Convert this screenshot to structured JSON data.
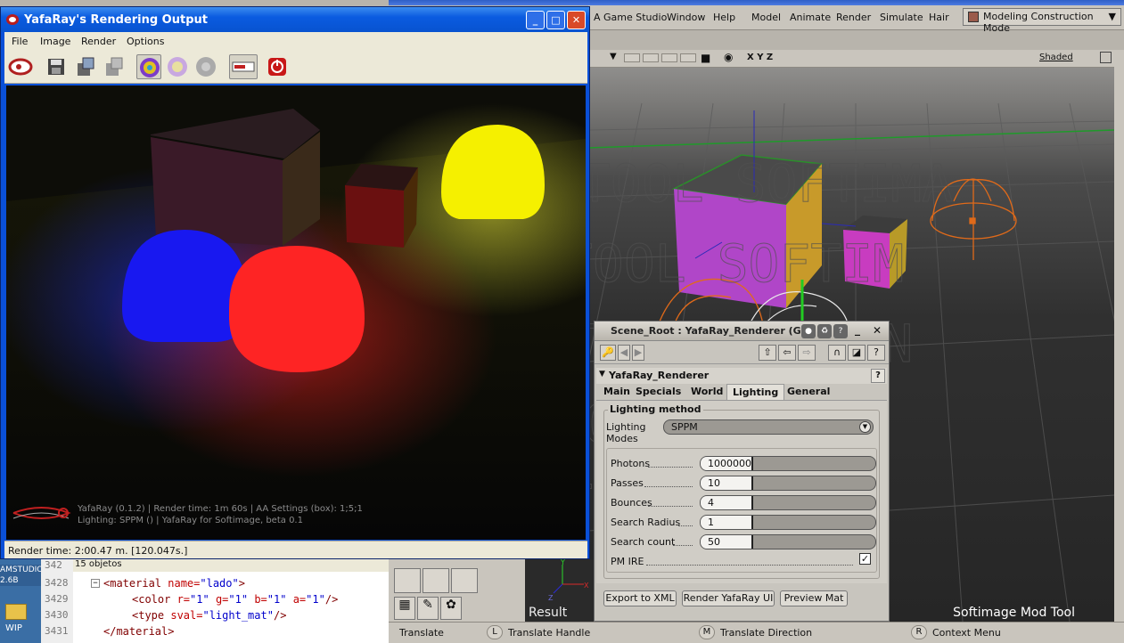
{
  "softimage": {
    "menus": [
      "A Game Studio",
      "Window",
      "Help",
      "Model",
      "Animate",
      "Render",
      "Simulate",
      "Hair"
    ],
    "mode_button": "Modeling Construction Mode",
    "view_axes": "X Y Z",
    "shading_mode": "Shaded",
    "status_bar": {
      "left_mouse": "Translate",
      "middle_key": "L",
      "middle_mouse": "Translate Handle",
      "m_key": "M",
      "m_action": "Translate Direction",
      "r_key": "R",
      "right_mouse": "Context Menu"
    },
    "result_label": "Result",
    "watermark_labels": "Softimage  Mod  Tool"
  },
  "desktop": {
    "icon_top_label": "AMSTUDIO 2.6B",
    "icon_bottom_label": "WIP"
  },
  "editor": {
    "header": "15 objetos",
    "line_numbers": [
      "342",
      "3428",
      "3429",
      "3430",
      "3431"
    ],
    "lines": [
      {
        "tag_open": "<material ",
        "attr": "name=",
        "val": "\"lado\"",
        "tag_close": ">"
      },
      {
        "tag_open": "<color ",
        "attr": "r=",
        "val": "\"1\"",
        "attr2": " g=",
        "val2": "\"1\"",
        "attr3": " b=",
        "val3": "\"1\"",
        "attr4": " a=",
        "val4": "\"1\"",
        "tag_close": "/>"
      },
      {
        "tag_open": "<type ",
        "attr": "sval=",
        "val": "\"light_mat\"",
        "tag_close": "/>"
      },
      {
        "tag_open": "</material>"
      }
    ]
  },
  "yafaray_window": {
    "title": "YafaRay's Rendering Output",
    "menus": [
      "File",
      "Image",
      "Render",
      "Options"
    ],
    "overlay_line1": "YafaRay (0.1.2) | Render time: 1m 60s | AA Settings (box): 1;5;1",
    "overlay_line2": "Lighting: SPPM () | YafaRay for Softimage, beta 0.1",
    "status": "Render time: 2:00.47 m. [120.047s.]"
  },
  "property_panel": {
    "title": "Scene_Root : YafaRay_Renderer (G...",
    "section": "YafaRay_Renderer",
    "tabs": [
      "Main",
      "Specials",
      "World",
      "Lighting",
      "General"
    ],
    "active_tab": "Lighting",
    "group_title": "Lighting method",
    "lighting_modes_label1": "Lighting",
    "lighting_modes_label2": "Modes",
    "lighting_mode_value": "SPPM",
    "params": [
      {
        "label": "Photons",
        "value": "1000000",
        "fill": 0.3
      },
      {
        "label": "Passes",
        "value": "10",
        "fill": 0.3
      },
      {
        "label": "Bounces",
        "value": "4",
        "fill": 0.3
      },
      {
        "label": "Search Radius",
        "value": "1",
        "fill": 0.3
      },
      {
        "label": "Search count",
        "value": "50",
        "fill": 0.3
      }
    ],
    "pm_ire_label": "PM IRE",
    "pm_ire_checked": true,
    "buttons": [
      "Export to XML",
      "Render YafaRay UI",
      "Preview Mat"
    ]
  }
}
